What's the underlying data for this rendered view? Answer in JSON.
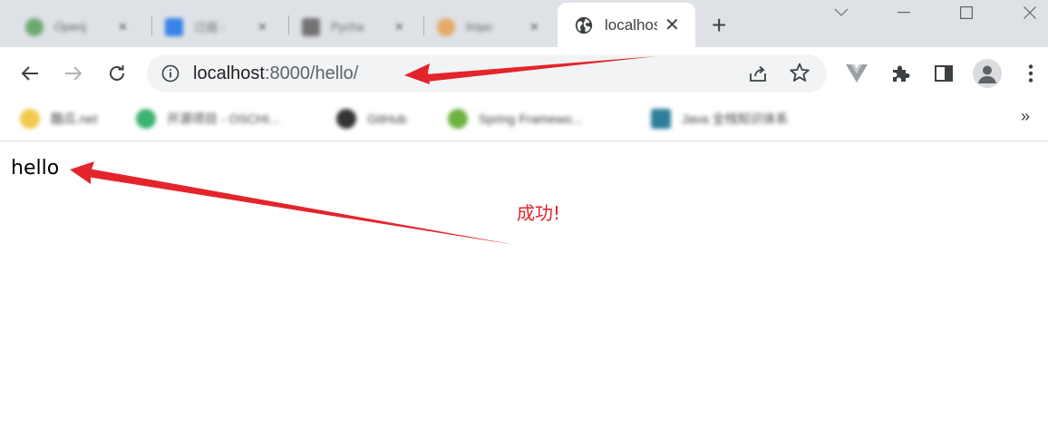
{
  "window": {
    "controls": {
      "minimize": "—",
      "maximize": "☐",
      "close": "✕"
    }
  },
  "tabs": [
    {
      "title": "Openj",
      "fav_color": "#5aa05a",
      "close": "✕"
    },
    {
      "title": "订阅 -",
      "fav_color": "#1a73e8",
      "close": "✕"
    },
    {
      "title": "Pycha",
      "fav_color": "#606060",
      "close": "✕"
    },
    {
      "title": "Impo",
      "fav_color": "#e8a050",
      "close": "✕"
    }
  ],
  "active_tab": {
    "title": "localhost",
    "icon": "globe-icon",
    "close": "✕"
  },
  "new_tab_label": "+",
  "omnibox": {
    "host": "localhost",
    "path": ":8000/hello/"
  },
  "bookmarks": {
    "items": [
      {
        "label": "酷瓜.net",
        "fav_color": "#f2c94c"
      },
      {
        "label": "开源项目 - OSCHI...",
        "fav_color": "#3cb371"
      },
      {
        "label": "GitHub",
        "fav_color": "#333333"
      },
      {
        "label": "Spring Framewo...",
        "fav_color": "#6db33f"
      },
      {
        "label": "Java 全栈知识体系",
        "fav_color": "#2e7d9a"
      }
    ],
    "more": "»"
  },
  "page": {
    "body_text": "hello",
    "annotation": "成功!"
  },
  "colors": {
    "annotation": "#e3242b",
    "tabstrip": "#dee1e6",
    "omnibox_bg": "#f1f3f4"
  }
}
